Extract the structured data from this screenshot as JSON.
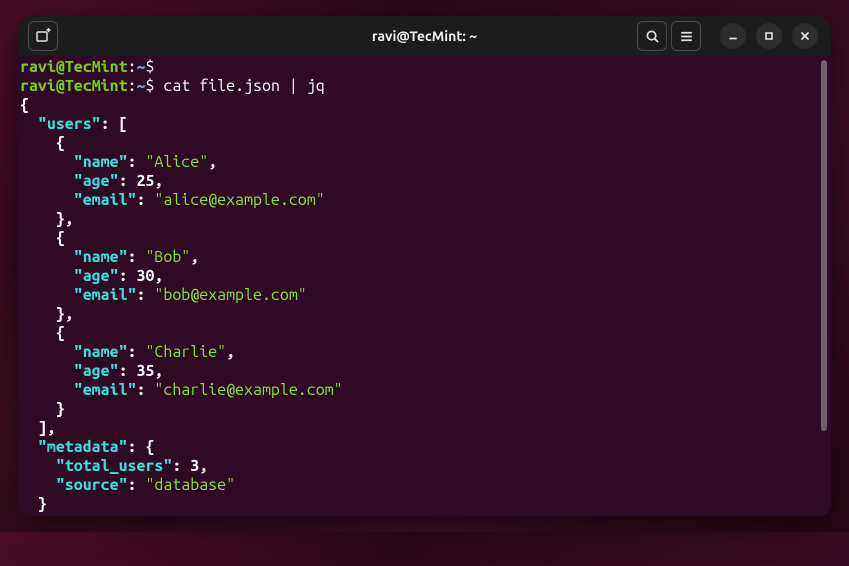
{
  "window": {
    "title": "ravi@TecMint: ~"
  },
  "titlebar": {
    "icons": {
      "newtab": "new-tab-icon",
      "search": "search-icon",
      "menu": "hamburger-menu-icon",
      "minimize": "minimize-icon",
      "maximize": "maximize-icon",
      "close": "close-icon"
    }
  },
  "prompt": {
    "user": "ravi",
    "at": "@",
    "host": "TecMint",
    "colon": ":",
    "path": "~",
    "dollar": "$"
  },
  "commands": {
    "line1": "",
    "line2": "cat file.json | jq"
  },
  "json_output": {
    "open_brace": "{",
    "users_key": "\"users\"",
    "colon_open_bracket": ": [",
    "obj_open": "    {",
    "name_key": "\"name\"",
    "age_key": "\"age\"",
    "email_key": "\"email\"",
    "colon_sp": ": ",
    "comma": ",",
    "obj_close_comma": "    },",
    "obj_close": "    }",
    "close_bracket_comma": "  ],",
    "metadata_key": "\"metadata\"",
    "colon_open_brace": ": {",
    "total_users_key": "\"total_users\"",
    "source_key": "\"source\"",
    "close_brace_indent": "  }",
    "users": [
      {
        "name": "\"Alice\"",
        "age": "25",
        "email": "\"alice@example.com\""
      },
      {
        "name": "\"Bob\"",
        "age": "30",
        "email": "\"bob@example.com\""
      },
      {
        "name": "\"Charlie\"",
        "age": "35",
        "email": "\"charlie@example.com\""
      }
    ],
    "metadata": {
      "total_users": "3",
      "source": "\"database\""
    }
  }
}
